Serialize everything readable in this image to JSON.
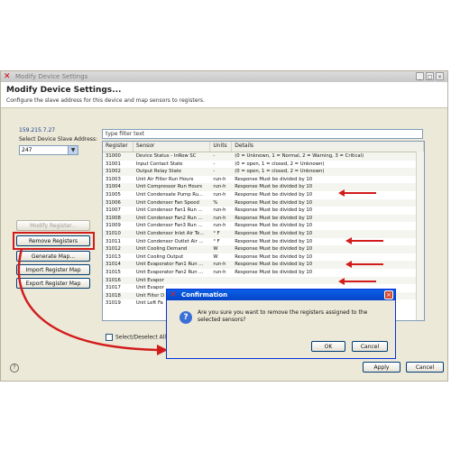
{
  "window": {
    "title": "Modify Device Settings",
    "heading": "Modify Device Settings...",
    "subtitle": "Configure the slave address for this device and map sensors to registers.",
    "minimize": "_",
    "maximize": "□",
    "close": "×"
  },
  "left": {
    "ip": "159.215.7.27",
    "slave_label": "Select Device Slave Address:",
    "slave_value": "247",
    "buttons": {
      "modify": "Modify Register...",
      "remove": "Remove Registers",
      "generate": "Generate Map...",
      "import": "Import Register Map",
      "export": "Export Register Map"
    }
  },
  "filter": {
    "placeholder": "type filter text"
  },
  "table": {
    "headers": [
      "Register",
      "Sensor",
      "Units",
      "Details"
    ],
    "rows": [
      [
        "31000",
        "Device Status - InRow SC",
        "-",
        "(0 = Unknown, 1 = Normal, 2 = Warning, 3 = Critical)"
      ],
      [
        "31001",
        "Input Contact State",
        "-",
        "(0 = open, 1 = closed, 2 = Unknown)"
      ],
      [
        "31002",
        "Output Relay State",
        "-",
        "(0 = open, 1 = closed, 2 = Unknown)"
      ],
      [
        "31003",
        "Unit Air Filter Run Hours",
        "run-h",
        "Response Must be divided by 10"
      ],
      [
        "31004",
        "Unit Compressor Run Hours",
        "run-h",
        "Response Must be divided by 10"
      ],
      [
        "31005",
        "Unit Condensate Pump Ru...",
        "run-h",
        "Response Must be divided by 10"
      ],
      [
        "31006",
        "Unit Condenser Fan Speed",
        "%",
        "Response Must be divided by 10"
      ],
      [
        "31007",
        "Unit Condenser Fan1 Run ...",
        "run-h",
        "Response Must be divided by 10"
      ],
      [
        "31008",
        "Unit Condenser Fan2 Run ...",
        "run-h",
        "Response Must be divided by 10"
      ],
      [
        "31009",
        "Unit Condenser Fan3 Run ...",
        "run-h",
        "Response Must be divided by 10"
      ],
      [
        "31010",
        "Unit Condenser Inlet Air Te...",
        "° F",
        "Response Must be divided by 10"
      ],
      [
        "31011",
        "Unit Condenser Outlet Air ...",
        "° F",
        "Response Must be divided by 10"
      ],
      [
        "31012",
        "Unit Cooling Demand",
        "W",
        "Response Must be divided by 10"
      ],
      [
        "31013",
        "Unit Cooling Output",
        "W",
        "Response Must be divided by 10"
      ],
      [
        "31014",
        "Unit Evaporator Fan1 Run ...",
        "run-h",
        "Response Must be divided by 10"
      ],
      [
        "31015",
        "Unit Evaporator Fan2 Run ...",
        "run-h",
        "Response Must be divided by 10"
      ],
      [
        "31016",
        "Unit Evapor",
        "",
        ""
      ],
      [
        "31017",
        "Unit Evapor",
        "",
        ""
      ],
      [
        "31018",
        "Unit Filter D",
        "",
        ""
      ],
      [
        "31019",
        "Unit Left Fa",
        "",
        ""
      ]
    ]
  },
  "select_all": "Select/Deselect All",
  "footer": {
    "apply": "Apply",
    "cancel": "Cancel",
    "help": "?"
  },
  "dialog": {
    "title": "Confirmation",
    "message": "Are you sure you want to remove the registers assigned to the selected sensors?",
    "ok": "OK",
    "cancel": "Cancel",
    "icon": "?",
    "close": "×"
  },
  "colors": {
    "highlight": "#d21c1c",
    "dialog_title": "#0545c8",
    "link": "#1a3d8c"
  }
}
